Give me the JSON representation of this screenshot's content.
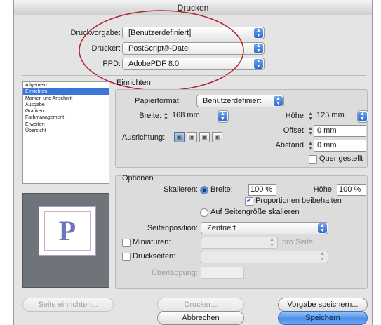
{
  "window": {
    "title": "Drucken"
  },
  "top": {
    "preset_label": "Druckvorgabe:",
    "preset_value": "[Benutzerdefiniert]",
    "printer_label": "Drucker:",
    "printer_value": "PostScript®-Datei",
    "ppd_label": "PPD:",
    "ppd_value": "AdobePDF 8.0"
  },
  "sidebar": {
    "items": [
      {
        "label": "Allgemein"
      },
      {
        "label": "Einrichten"
      },
      {
        "label": "Marken und Anschnitt"
      },
      {
        "label": "Ausgabe"
      },
      {
        "label": "Grafiken"
      },
      {
        "label": "Farbmanagement"
      },
      {
        "label": "Erweitert"
      },
      {
        "label": "Übersicht"
      }
    ],
    "selected_index": 1
  },
  "preview": {
    "letter": "P"
  },
  "einrichten": {
    "heading": "Einrichten",
    "paper_label": "Papierformat:",
    "paper_value": "Benutzerdefiniert",
    "width_label": "Breite:",
    "width_value": "168 mm",
    "height_label": "Höhe:",
    "height_value": "125 mm",
    "offset_label": "Offset:",
    "offset_value": "0 mm",
    "orientation_label": "Ausrichtung:",
    "gap_label": "Abstand:",
    "gap_value": "0 mm",
    "landscape_label": "Quer gestellt",
    "landscape_checked": false
  },
  "optionen": {
    "heading": "Optionen",
    "scale_label": "Skalieren:",
    "scale_width_label": "Breite:",
    "scale_width_value": "100 %",
    "scale_height_label": "Höhe:",
    "scale_height_value": "100 %",
    "keep_proportions_label": "Proportionen beibehalten",
    "keep_proportions_checked": true,
    "fit_page_label": "Auf Seitengröße skalieren",
    "position_label": "Seitenposition:",
    "position_value": "Zentriert",
    "thumbnails_label": "Miniaturen:",
    "per_page_label": "pro Seite",
    "tile_label": "Druckseiten:",
    "overlap_label": "Überlappung:"
  },
  "buttons": {
    "page_setup": "Seite einrichten...",
    "printer": "Drucker...",
    "save_preset": "Vorgabe speichern...",
    "cancel": "Abbrechen",
    "save": "Speichern"
  },
  "colors": {
    "accent": "#3a75d8",
    "annotation": "#b3202e"
  }
}
